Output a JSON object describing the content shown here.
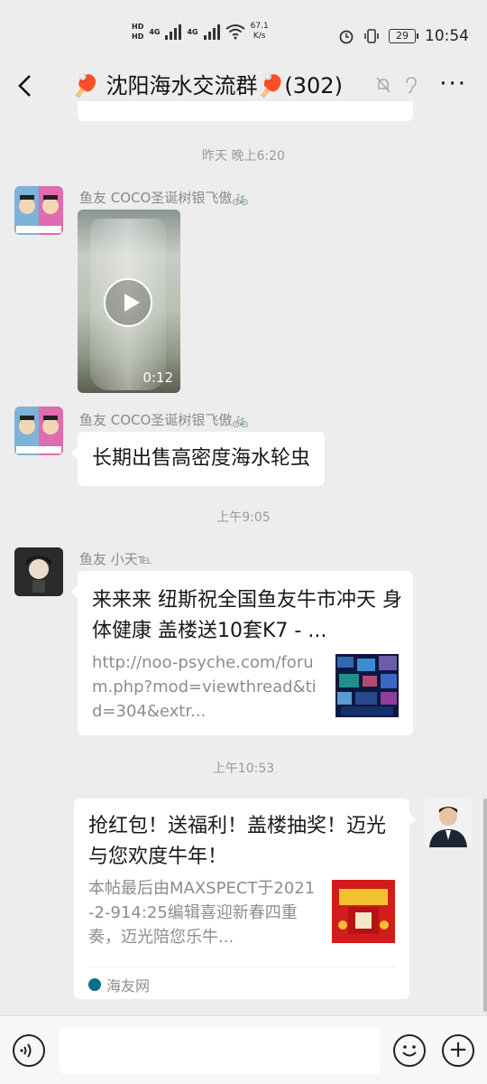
{
  "status_bar": {
    "hd1": "HD",
    "hd2": "HD",
    "net1": "4G",
    "net2": "4G",
    "speed_value": "67.1",
    "speed_unit": "K/s",
    "battery": "29",
    "time": "10:54"
  },
  "header": {
    "back_icon": "chevron-left-icon",
    "title": "🏓 沈阳海水交流群🏓(302)",
    "mute_icon": "bell-off-icon",
    "earpiece_icon": "ear-icon",
    "more_label": "···"
  },
  "messages": [
    {
      "type": "time",
      "text": "昨天 晚上6:20"
    },
    {
      "type": "video",
      "sender": "鱼友 COCO圣诞树银飞傲🚲",
      "duration": "0:12"
    },
    {
      "type": "text",
      "sender": "鱼友 COCO圣诞树银飞傲🚲",
      "text": "长期出售高密度海水轮虫"
    },
    {
      "type": "time",
      "text": "上午9:05"
    },
    {
      "type": "link",
      "sender": "鱼友 小天℡",
      "title": "来来来 纽斯祝全国鱼友牛市冲天 身体健康 盖楼送10套K7 - ...",
      "desc": "http://noo-psyche.com/forum.php?mod=viewthread&tid=304&extr..."
    },
    {
      "type": "time",
      "text": "上午10:53"
    },
    {
      "type": "link-self",
      "title": "抢红包！送福利！盖楼抽奖！迈光与您欢度牛年！",
      "desc": "本帖最后由MAXSPECT于2021-2-914:25编辑喜迎新春四重奏，迈光陪您乐牛...",
      "source": "海友网"
    }
  ],
  "input_bar": {
    "voice_icon": "voice-icon",
    "emoji_icon": "emoji-icon",
    "plus_label": "+"
  },
  "colors": {
    "background": "#ededed",
    "bubble": "#ffffff",
    "timestamp": "#9a9a9a"
  }
}
